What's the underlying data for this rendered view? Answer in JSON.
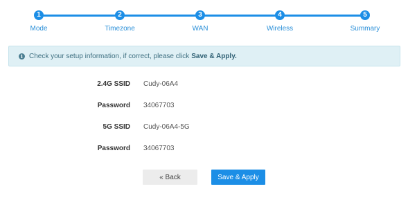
{
  "stepper": {
    "steps": [
      {
        "number": "1",
        "label": "Mode"
      },
      {
        "number": "2",
        "label": "Timezone"
      },
      {
        "number": "3",
        "label": "WAN"
      },
      {
        "number": "4",
        "label": "Wireless"
      },
      {
        "number": "5",
        "label": "Summary"
      }
    ],
    "accent_color": "#1c8ee6"
  },
  "info": {
    "icon": "info-circle-icon",
    "text": "Check your setup information, if correct, please click",
    "bold_text": "Save & Apply."
  },
  "summary": {
    "rows": [
      {
        "label": "2.4G SSID",
        "value": "Cudy-06A4"
      },
      {
        "label": "Password",
        "value": "34067703"
      },
      {
        "label": "5G SSID",
        "value": "Cudy-06A4-5G"
      },
      {
        "label": "Password",
        "value": "34067703"
      }
    ]
  },
  "buttons": {
    "back_label": "« Back",
    "save_label": "Save & Apply"
  }
}
